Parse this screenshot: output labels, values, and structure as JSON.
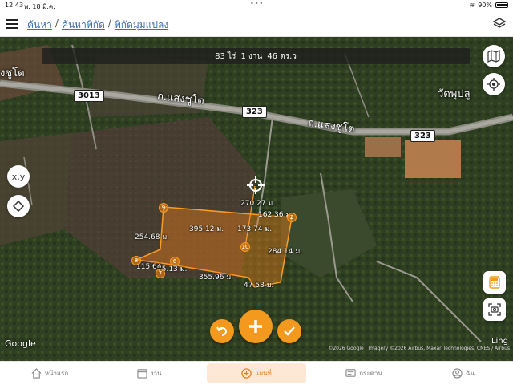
{
  "status": {
    "time": "12:43",
    "date": "พ. 18 มี.ค.",
    "battery": "90%"
  },
  "header": {
    "breadcrumb": [
      "ค้นหา",
      "ค้นหาพิกัด",
      "พิกัดมุมแปลง"
    ]
  },
  "area": {
    "rai": "83 ไร่",
    "ngan": "1 งาน",
    "wa": "46 ตร.ว"
  },
  "map": {
    "roads": [
      {
        "label": "ถ.แสงชูโต"
      },
      {
        "label": "ถ.แสงชูโต"
      }
    ],
    "shields": [
      "3013",
      "323",
      "323"
    ],
    "places": [
      "งชูโต",
      "วัดพุปลู"
    ],
    "measurements": [
      "270.27 ม.",
      "162.36 ม.",
      "395.12 ม.",
      "173.74 ม.",
      "254.68 ม.",
      "284.14 ม.",
      "115.64",
      "75.13 ม.",
      "355.96 ม.",
      "47.58 ม."
    ],
    "vertices": [
      "9",
      "10",
      "8",
      "6",
      "7",
      "2"
    ],
    "google": "Google",
    "attribution": "©2026 Google · Imagery ©2026 Airbus, Maxar Technologies, CNES / Airbus",
    "ling": "Ling"
  },
  "tools": {
    "xy": "x,y"
  },
  "nav": [
    {
      "label": "หน้าแรก",
      "icon": "home-icon"
    },
    {
      "label": "งาน",
      "icon": "calendar-icon"
    },
    {
      "label": "แผนที่",
      "icon": "add-map-icon"
    },
    {
      "label": "กระดาน",
      "icon": "message-icon"
    },
    {
      "label": "ฉัน",
      "icon": "user-icon"
    }
  ],
  "colors": {
    "accent": "#f39a1e",
    "polygon": "#e07a1a",
    "link": "#3b6fb6"
  }
}
